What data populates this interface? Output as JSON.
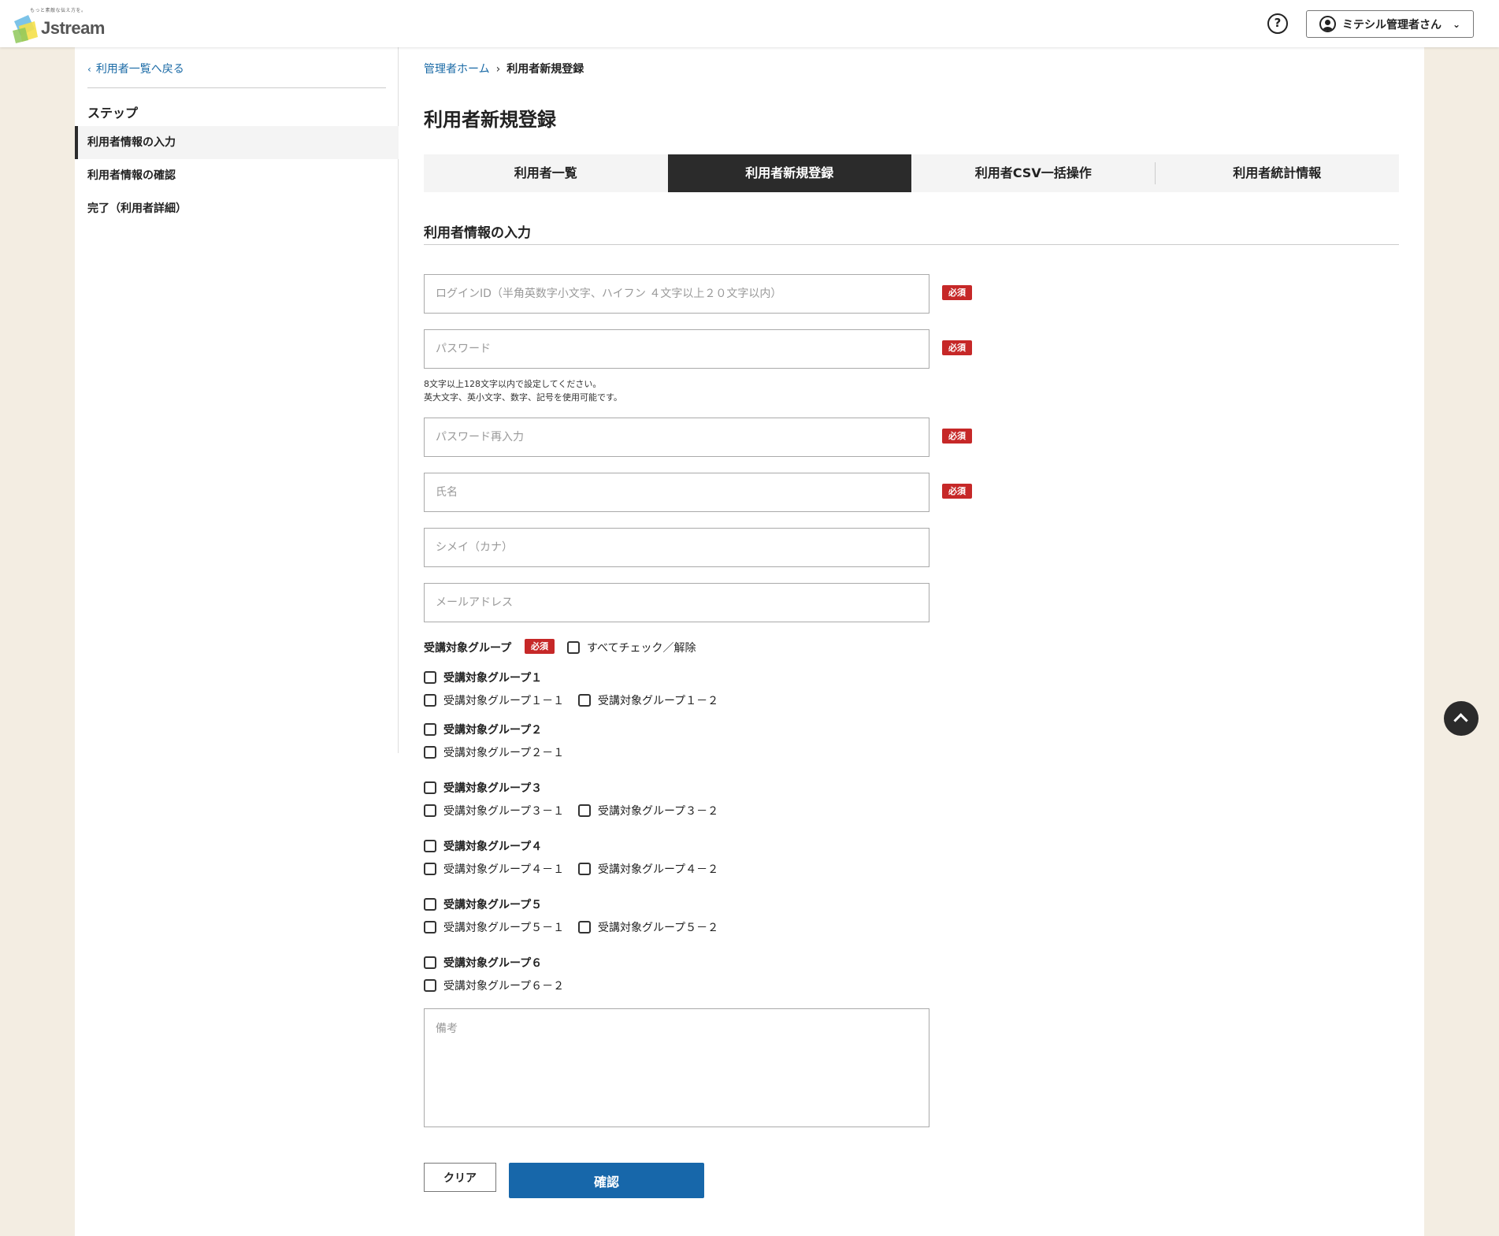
{
  "header": {
    "logo_tagline": "もっと素敵な伝え方を。",
    "logo_text": "Jstream",
    "help_label": "?",
    "user_label": "ミテシル管理者さん"
  },
  "sidebar": {
    "back_label": "利用者一覧へ戻る",
    "steps_title": "ステップ",
    "steps": [
      {
        "label": "利用者情報の入力",
        "active": true
      },
      {
        "label": "利用者情報の確認",
        "active": false
      },
      {
        "label": "完了（利用者詳細）",
        "active": false
      }
    ]
  },
  "breadcrumb": {
    "home": "管理者ホーム",
    "current": "利用者新規登録"
  },
  "page_title": "利用者新規登録",
  "tabs": [
    {
      "label": "利用者一覧",
      "active": false
    },
    {
      "label": "利用者新規登録",
      "active": true
    },
    {
      "label": "利用者CSV一括操作",
      "active": false
    },
    {
      "label": "利用者統計情報",
      "active": false
    }
  ],
  "section_title": "利用者情報の入力",
  "required_label": "必須",
  "form": {
    "login_id_placeholder": "ログインID（半角英数字小文字、ハイフン ４文字以上２０文字以内）",
    "password_placeholder": "パスワード",
    "password_hint_1": "8文字以上128文字以内で設定してください。",
    "password_hint_2": "英大文字、英小文字、数字、記号を使用可能です。",
    "password_confirm_placeholder": "パスワード再入力",
    "name_placeholder": "氏名",
    "kana_placeholder": "シメイ（カナ）",
    "email_placeholder": "メールアドレス",
    "notes_placeholder": "備考"
  },
  "groups": {
    "label": "受講対象グループ",
    "check_all_label": "すべてチェック／解除",
    "items": [
      {
        "name": "受講対象グループ１",
        "children": [
          "受講対象グループ１－１",
          "受講対象グループ１－２"
        ]
      },
      {
        "name": "受講対象グループ２",
        "children": [
          "受講対象グループ２－１"
        ]
      },
      {
        "name": "受講対象グループ３",
        "children": [
          "受講対象グループ３－１",
          "受講対象グループ３－２"
        ]
      },
      {
        "name": "受講対象グループ４",
        "children": [
          "受講対象グループ４－１",
          "受講対象グループ４－２"
        ]
      },
      {
        "name": "受講対象グループ５",
        "children": [
          "受講対象グループ５－１",
          "受講対象グループ５－２"
        ]
      },
      {
        "name": "受講対象グループ６",
        "children": [
          "受講対象グループ６－２"
        ]
      }
    ]
  },
  "buttons": {
    "clear": "クリア",
    "confirm": "確認"
  },
  "colors": {
    "accent": "#1767aa",
    "required": "#c62828",
    "dark": "#2b2b2b",
    "background": "#f3ede2"
  }
}
